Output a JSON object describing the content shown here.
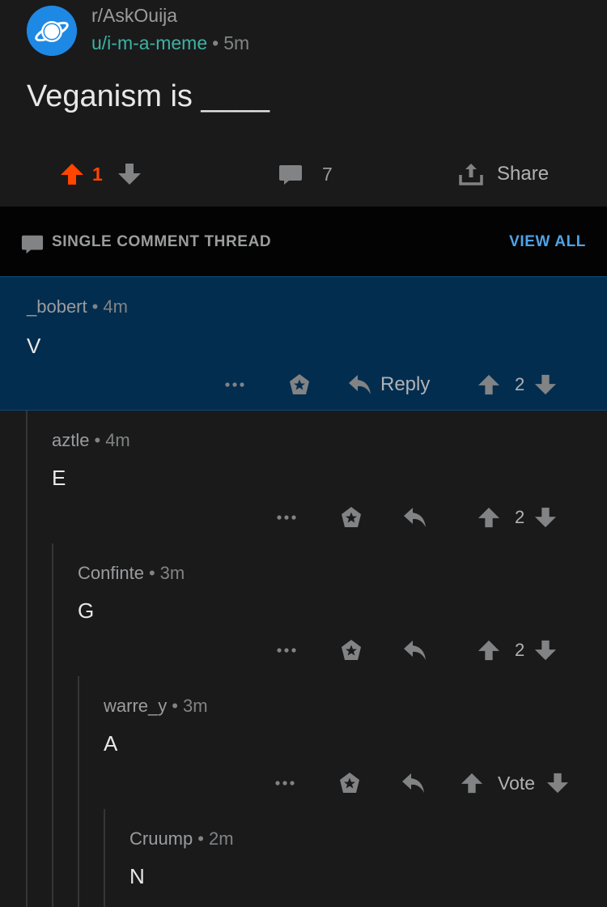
{
  "post": {
    "subreddit": "r/AskOuija",
    "author": "u/i-m-a-meme",
    "separator": "•",
    "age": "5m",
    "title": "Veganism is ____",
    "upvotes": "1",
    "comments": "7",
    "share_label": "Share"
  },
  "thread": {
    "label": "SINGLE COMMENT THREAD",
    "view_all": "VIEW ALL"
  },
  "comments": [
    {
      "user": "_bobert",
      "age": "4m",
      "body": "V",
      "reply_label": "Reply",
      "score": "2"
    },
    {
      "user": "aztle",
      "age": "4m",
      "body": "E",
      "score": "2"
    },
    {
      "user": "Confinte",
      "age": "3m",
      "body": "G",
      "score": "2"
    },
    {
      "user": "warre_y",
      "age": "3m",
      "body": "A",
      "score": "Vote"
    },
    {
      "user": "Cruump",
      "age": "2m",
      "body": "N"
    }
  ],
  "colors": {
    "upvote_active": "#ff4500",
    "author": "#3bb3a4",
    "link": "#4fa3e8",
    "highlight": "#032d4f"
  },
  "icons": [
    "planet-icon",
    "upvote-arrow-icon",
    "downvote-arrow-icon",
    "comment-bubble-icon",
    "share-icon",
    "more-dots-icon",
    "award-icon",
    "reply-arrow-icon"
  ]
}
